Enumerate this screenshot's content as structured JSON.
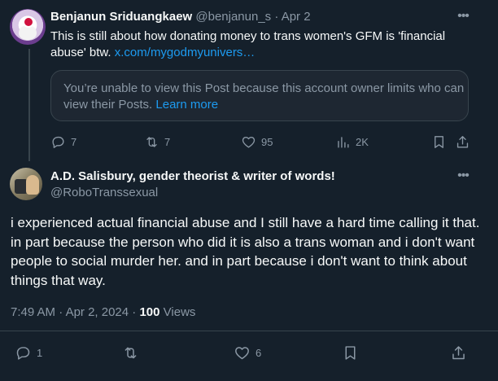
{
  "quoted_tweet": {
    "author_name": "Benjanun Sriduangkaew",
    "author_handle": "@benjanun_s",
    "separator": "·",
    "date": "Apr 2",
    "text": "This is still about how donating money to trans women's GFM is 'financial abuse' btw.",
    "link_text": "x.com/mygodmyunivers…",
    "card": {
      "message": "You’re unable to view this Post because this account owner limits who can view their Posts.",
      "learn_more": "Learn more"
    },
    "stats": {
      "replies": "7",
      "reposts": "7",
      "likes": "95",
      "views": "2K"
    }
  },
  "main_tweet": {
    "author_name": "A.D. Salisbury, gender theorist & writer of words!",
    "author_handle": "@RoboTranssexual",
    "text": "i experienced actual financial abuse and I still have a hard time calling it that. in part because the person who did it is also a trans woman and i don't want people to social murder her. and in part because i don't want to think about things that way.",
    "time": "7:49 AM",
    "date": "Apr 2, 2024",
    "separator": "·",
    "views_count": "100",
    "views_label": "Views",
    "stats": {
      "replies": "1",
      "likes": "6"
    }
  },
  "icons": {
    "more": "more-horizontal-icon",
    "reply": "reply-icon",
    "repost": "repost-icon",
    "like": "heart-icon",
    "views": "views-chart-icon",
    "bookmark": "bookmark-icon",
    "share": "share-icon"
  },
  "colors": {
    "background": "#15202b",
    "text": "#f7f9f9",
    "muted": "#8b98a5",
    "link": "#1d9bf0",
    "border": "#38444d"
  }
}
